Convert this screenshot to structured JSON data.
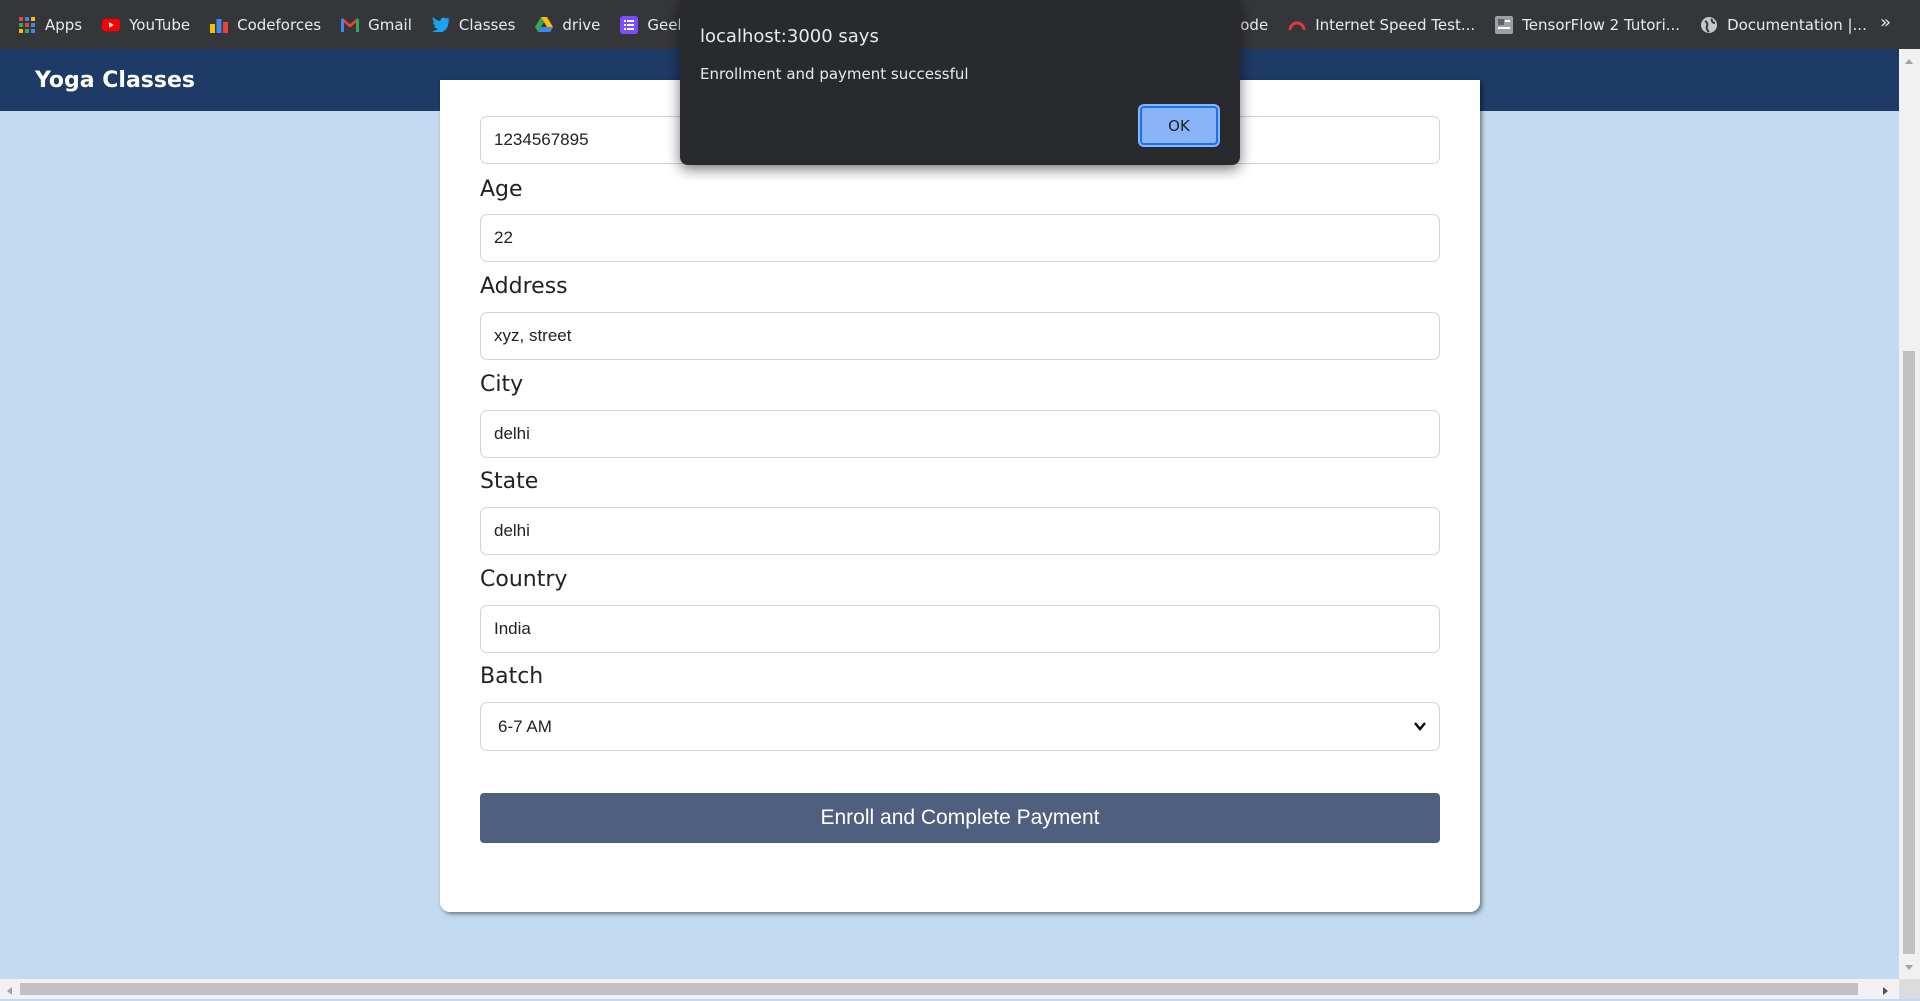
{
  "bookmarks": {
    "items": [
      {
        "label": "Apps",
        "icon": "apps-grid-icon"
      },
      {
        "label": "YouTube",
        "icon": "youtube-icon"
      },
      {
        "label": "Codeforces",
        "icon": "codeforces-icon"
      },
      {
        "label": "Gmail",
        "icon": "gmail-icon"
      },
      {
        "label": "Classes",
        "icon": "twitter-bird-icon"
      },
      {
        "label": "drive",
        "icon": "google-drive-icon"
      },
      {
        "label": "Geeksf",
        "icon": "list-icon"
      }
    ],
    "right_items": [
      {
        "label": "code"
      },
      {
        "label": "Internet Speed Test...",
        "icon": "speedometer-icon"
      },
      {
        "label": "TensorFlow 2 Tutori...",
        "icon": "document-icon"
      },
      {
        "label": "Documentation |...",
        "icon": "globe-icon"
      }
    ],
    "more": "»"
  },
  "navbar": {
    "brand": "Yoga Classes",
    "color": "#1e3a66"
  },
  "form": {
    "phone_value": "1234567895",
    "age_label": "Age",
    "age_value": "22",
    "address_label": "Address",
    "address_value": "xyz, street",
    "city_label": "City",
    "city_value": "delhi",
    "state_label": "State",
    "state_value": "delhi",
    "country_label": "Country",
    "country_value": "India",
    "batch_label": "Batch",
    "batch_value": "6-7 AM",
    "submit_label": "Enroll and Complete Payment",
    "submit_color": "#4e5f80"
  },
  "dialog": {
    "title": "localhost:3000 says",
    "message": "Enrollment and payment successful",
    "ok_label": "OK"
  },
  "colors": {
    "page_background": "#c3d9ef",
    "bookmarks_bar": "#35363a"
  }
}
